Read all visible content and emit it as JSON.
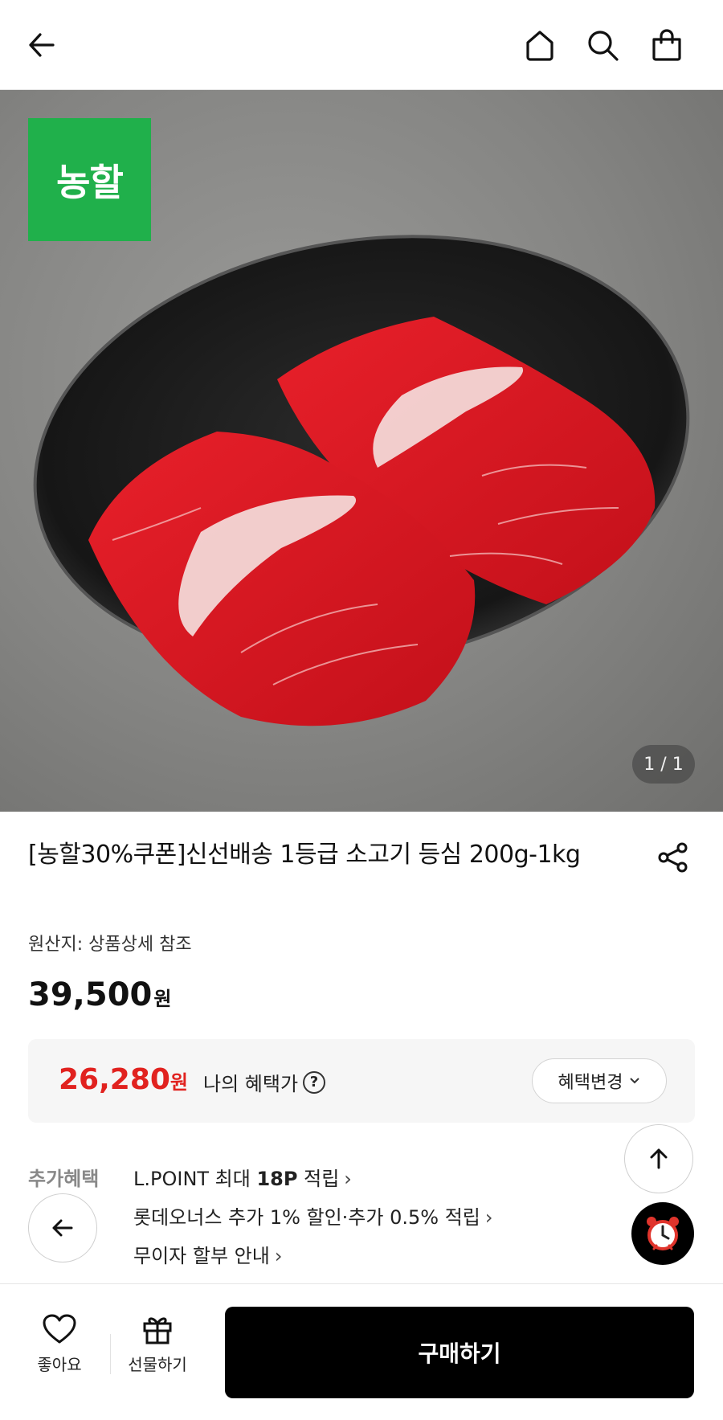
{
  "header": {
    "back_icon": "arrow-left-icon",
    "home_icon": "home-icon",
    "search_icon": "search-icon",
    "cart_icon": "shopping-bag-icon"
  },
  "gallery": {
    "brand_badge": "농할",
    "counter": "1 / 1",
    "image_description_icon": "beef-photo"
  },
  "product": {
    "title": "[농할30%쿠폰]신선배송 1등급 소고기 등심 200g-1kg",
    "origin": "원산지: 상품상세 참조",
    "price": "39,500",
    "price_unit": "원"
  },
  "benefit": {
    "price": "26,280",
    "price_unit": "원",
    "label": "나의 혜택가",
    "help": "?",
    "change_button": "혜택변경",
    "accent_color": "#e1221f"
  },
  "extra": {
    "label": "추가혜택",
    "lpoint_prefix": "L.POINT 최대 ",
    "lpoint_bold": "18P",
    "lpoint_suffix": " 적립",
    "card": "롯데오너스 추가 1% 할인·추가 0.5% 적립",
    "installment": "무이자 할부 안내",
    "chevron": "›"
  },
  "bottom": {
    "like_label": "좋아요",
    "gift_label": "선물하기",
    "buy_label": "구매하기"
  },
  "colors": {
    "brand_green": "#20b04b",
    "buy_button": "#000000"
  }
}
